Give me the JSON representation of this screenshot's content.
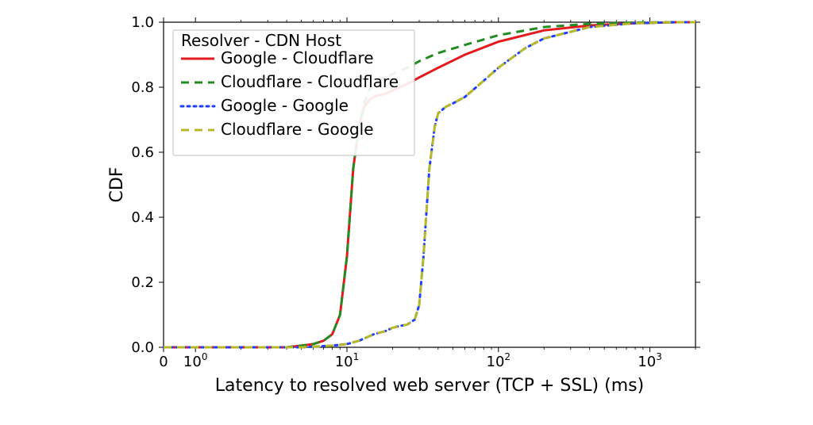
{
  "chart_data": {
    "type": "line",
    "title": "",
    "xlabel": "Latency to resolved web server (TCP + SSL) (ms)",
    "ylabel": "CDF",
    "xscale": "symlog",
    "xlim": [
      0,
      2000
    ],
    "ylim": [
      0.0,
      1.0
    ],
    "yticks": [
      0.0,
      0.2,
      0.4,
      0.6,
      0.8,
      1.0
    ],
    "xticks_major": [
      0,
      1,
      10,
      100,
      1000
    ],
    "xtick_labels": [
      "0",
      "10^0",
      "10^1",
      "10^2",
      "10^3"
    ],
    "legend": {
      "title": "Resolver - CDN Host",
      "position": "upper left",
      "entries": [
        "Google - Cloudflare",
        "Cloudflare - Cloudflare",
        "Google - Google",
        "Cloudflare - Google"
      ]
    },
    "series": [
      {
        "name": "Google - Cloudflare",
        "color": "#e41a1c",
        "dash": "solid",
        "x": [
          0,
          2,
          4,
          5,
          6,
          7,
          8,
          9,
          10,
          11,
          12,
          13,
          14,
          15,
          16,
          18,
          20,
          25,
          30,
          40,
          60,
          100,
          200,
          400,
          800,
          1500,
          2000
        ],
        "cdf": [
          0.0,
          0.0,
          0.0,
          0.005,
          0.01,
          0.02,
          0.04,
          0.1,
          0.28,
          0.55,
          0.68,
          0.74,
          0.76,
          0.77,
          0.775,
          0.78,
          0.79,
          0.81,
          0.83,
          0.86,
          0.9,
          0.94,
          0.975,
          0.99,
          0.997,
          1.0,
          1.0
        ]
      },
      {
        "name": "Cloudflare - Cloudflare",
        "color": "#228b22",
        "dash": "dashed",
        "x": [
          0,
          2,
          4,
          5,
          6,
          7,
          8,
          9,
          10,
          11,
          12,
          13,
          14,
          15,
          16,
          18,
          20,
          25,
          30,
          40,
          60,
          100,
          200,
          400,
          800,
          1500,
          2000
        ],
        "cdf": [
          0.0,
          0.0,
          0.0,
          0.005,
          0.01,
          0.02,
          0.04,
          0.1,
          0.28,
          0.55,
          0.68,
          0.75,
          0.79,
          0.81,
          0.82,
          0.83,
          0.84,
          0.86,
          0.88,
          0.905,
          0.93,
          0.96,
          0.985,
          0.995,
          0.999,
          1.0,
          1.0
        ]
      },
      {
        "name": "Google - Google",
        "color": "#1f3fff",
        "dash": "dotted",
        "x": [
          0,
          5,
          8,
          10,
          12,
          15,
          18,
          20,
          22,
          25,
          28,
          30,
          32,
          35,
          38,
          40,
          45,
          50,
          60,
          80,
          100,
          150,
          200,
          400,
          800,
          1500,
          2000
        ],
        "cdf": [
          0.0,
          0.0,
          0.005,
          0.01,
          0.02,
          0.04,
          0.05,
          0.06,
          0.065,
          0.07,
          0.085,
          0.13,
          0.28,
          0.55,
          0.68,
          0.72,
          0.74,
          0.75,
          0.77,
          0.82,
          0.86,
          0.92,
          0.95,
          0.985,
          0.997,
          1.0,
          1.0
        ]
      },
      {
        "name": "Cloudflare - Google",
        "color": "#b8b827",
        "dash": "dashed",
        "x": [
          0,
          5,
          8,
          10,
          12,
          15,
          18,
          20,
          22,
          25,
          28,
          30,
          32,
          35,
          38,
          40,
          45,
          50,
          60,
          80,
          100,
          150,
          200,
          400,
          800,
          1500,
          2000
        ],
        "cdf": [
          0.0,
          0.0,
          0.005,
          0.01,
          0.02,
          0.04,
          0.05,
          0.06,
          0.065,
          0.07,
          0.085,
          0.13,
          0.28,
          0.55,
          0.68,
          0.72,
          0.74,
          0.75,
          0.77,
          0.82,
          0.86,
          0.92,
          0.95,
          0.985,
          0.997,
          1.0,
          1.0
        ]
      }
    ]
  }
}
